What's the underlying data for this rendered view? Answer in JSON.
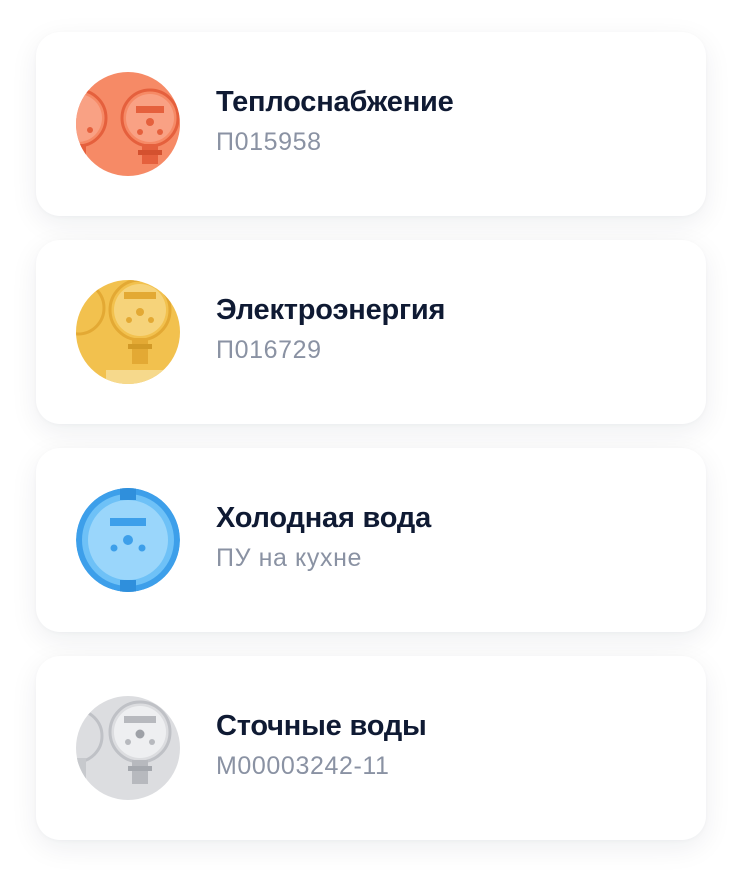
{
  "meters": [
    {
      "title": "Теплоснабжение",
      "subtitle": "П015958",
      "icon": "heat-meter-icon",
      "color": "#f68a66"
    },
    {
      "title": "Электроэнергия",
      "subtitle": "П016729",
      "icon": "electricity-meter-icon",
      "color": "#f2c14e"
    },
    {
      "title": "Холодная вода",
      "subtitle": "ПУ на кухне",
      "icon": "cold-water-meter-icon",
      "color": "#6ec1f7"
    },
    {
      "title": "Сточные воды",
      "subtitle": "М00003242-11",
      "icon": "wastewater-meter-icon",
      "color": "#dcdde0"
    }
  ]
}
